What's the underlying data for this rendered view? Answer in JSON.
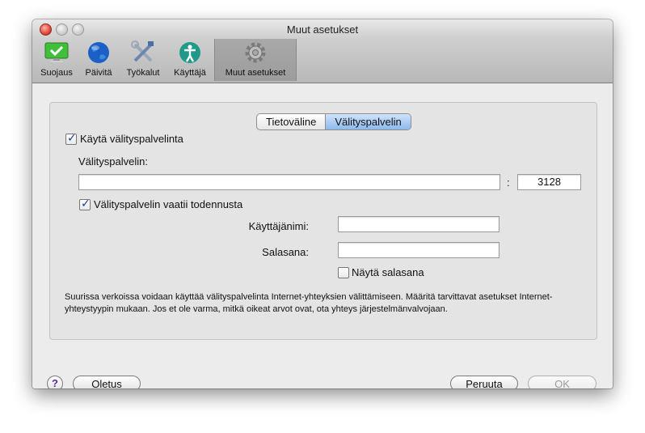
{
  "window": {
    "title": "Muut asetukset"
  },
  "toolbar": {
    "items": [
      {
        "label": "Suojaus",
        "icon": "monitor-check-icon"
      },
      {
        "label": "Päivitä",
        "icon": "globe-icon"
      },
      {
        "label": "Työkalut",
        "icon": "tools-icon"
      },
      {
        "label": "Käyttäjä",
        "icon": "user-icon"
      },
      {
        "label": "Muut asetukset",
        "icon": "gear-icon",
        "selected": true
      }
    ]
  },
  "tabs": [
    {
      "label": "Tietoväline",
      "active": false
    },
    {
      "label": "Välityspalvelin",
      "active": true
    }
  ],
  "proxy": {
    "use_proxy_label": "Käytä välityspalvelinta",
    "use_proxy_checked": true,
    "server_label": "Välityspalvelin:",
    "server_value": "",
    "port_separator": ":",
    "port_value": "3128",
    "auth_label": "Välityspalvelin vaatii todennusta",
    "auth_checked": true,
    "username_label": "Käyttäjänimi:",
    "username_value": "",
    "password_label": "Salasana:",
    "password_value": "",
    "show_password_label": "Näytä salasana",
    "show_password_checked": false,
    "description": "Suurissa verkoissa voidaan käyttää välityspalvelinta Internet-yhteyksien välittämiseen. Määritä tarvittavat asetukset Internet-yhteystyypin mukaan. Jos et ole varma, mitkä oikeat arvot ovat, ota yhteys järjestelmänvalvojaan."
  },
  "footer": {
    "help_label": "?",
    "default_label": "Oletus",
    "cancel_label": "Peruuta",
    "ok_label": "OK"
  },
  "check_glyph": "✓"
}
